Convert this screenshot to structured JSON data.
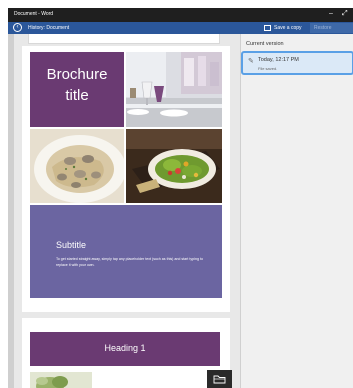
{
  "titlebar": {
    "title": "Document - Word",
    "minimize": "–",
    "maximize": "⤢"
  },
  "command_bar": {
    "back_glyph": "‹",
    "document_title": "History: Document",
    "save_copy_label": "Save a copy",
    "restore_label": "Restore"
  },
  "document": {
    "cover_title": "Brochure\ntitle",
    "subtitle": "Subtitle",
    "body_text": "To get started straight away, simply tap any placeholder text (such as this) and start typing to replace it with your own.",
    "heading": "Heading 1"
  },
  "versions_pane": {
    "heading": "Current version",
    "item_time": "Today, 12:17 PM",
    "item_note": "File saved."
  },
  "colors": {
    "purple_dark": "#6a3a72",
    "purple_light": "#6b65a1",
    "command_blue": "#2b579a",
    "selection_border": "#5aa0e6"
  }
}
